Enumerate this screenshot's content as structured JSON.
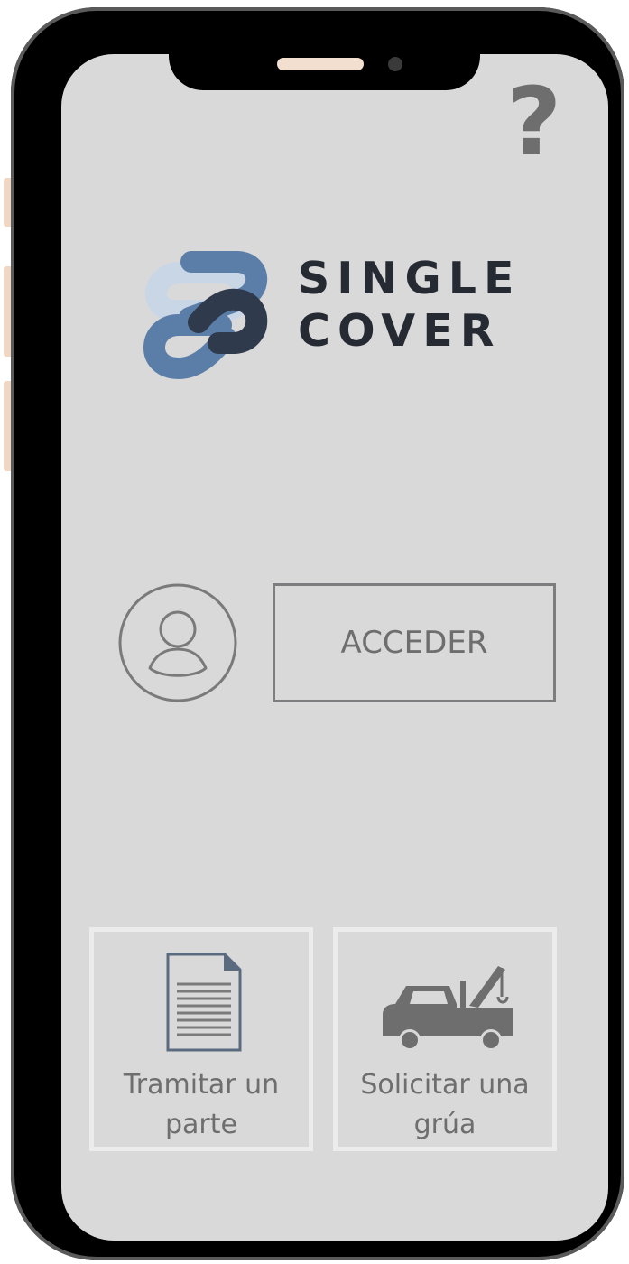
{
  "header": {
    "help_label": "?"
  },
  "brand": {
    "line1": "SINGLE",
    "line2": "COVER"
  },
  "login": {
    "button_label": "ACCEDER"
  },
  "actions": [
    {
      "line1": "Tramitar un",
      "line2": "parte",
      "icon": "document-icon"
    },
    {
      "line1": "Solicitar una",
      "line2": "grúa",
      "icon": "tow-truck-icon"
    }
  ],
  "colors": {
    "screen_background": "#d9d9d9",
    "frame": "#000000",
    "text_gray": "#6e6e6e",
    "brand_dark": "#262a33",
    "logo_blue": "#5b7ea8",
    "logo_light": "#c9d6e6",
    "logo_navy": "#2f3a4c",
    "card_border": "#ececec"
  }
}
